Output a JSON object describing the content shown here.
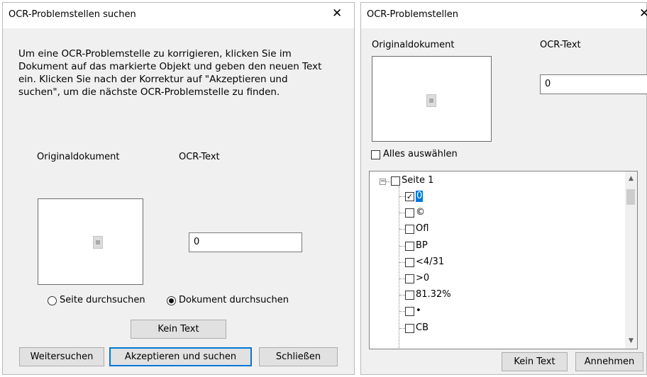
{
  "left_dialog": {
    "title": "OCR-Problemstellen suchen",
    "instructions": [
      "Um eine OCR-Problemstelle zu korrigieren, klicken Sie im",
      "Dokument auf das markierte Objekt und geben den neuen Text",
      "ein. Klicken Sie nach der Korrektur auf \"Akzeptieren und",
      "suchen\", um die nächste OCR-Problemstelle zu finden."
    ],
    "original_label": "Originaldokument",
    "ocr_label": "OCR-Text",
    "ocr_value": "0",
    "radio_page": "Seite durchsuchen",
    "radio_document": "Dokument durchsuchen",
    "search_scope": "document",
    "no_text_button": "Kein Text",
    "find_next_button": "Weitersuchen",
    "accept_button": "Akzeptieren und suchen",
    "close_button": "Schließen"
  },
  "right_dialog": {
    "title": "OCR-Problemstellen",
    "original_label": "Originaldokument",
    "ocr_label": "OCR-Text",
    "ocr_value": "0",
    "select_all_label": "Alles auswählen",
    "tree": {
      "root_label": "Seite 1",
      "items": [
        {
          "label": "0",
          "checked": true,
          "selected": true
        },
        {
          "label": "©",
          "checked": false,
          "selected": false
        },
        {
          "label": "Ofl",
          "checked": false,
          "selected": false
        },
        {
          "label": "BP",
          "checked": false,
          "selected": false
        },
        {
          "label": "<4/31",
          "checked": false,
          "selected": false
        },
        {
          "label": ">0",
          "checked": false,
          "selected": false
        },
        {
          "label": "81.32%",
          "checked": false,
          "selected": false
        },
        {
          "label": "•",
          "checked": false,
          "selected": false
        },
        {
          "label": "CB",
          "checked": false,
          "selected": false
        }
      ]
    },
    "no_text_button": "Kein Text",
    "accept_button": "Annehmen"
  },
  "icons": {
    "close": "close-icon",
    "check": "check-icon",
    "collapse": "minus-icon",
    "scroll_up": "chevron-up-icon",
    "scroll_down": "chevron-down-icon"
  },
  "colors": {
    "dialog_bg": "#f0f0f0",
    "accent": "#0078d7",
    "button_bg": "#e1e1e1"
  }
}
